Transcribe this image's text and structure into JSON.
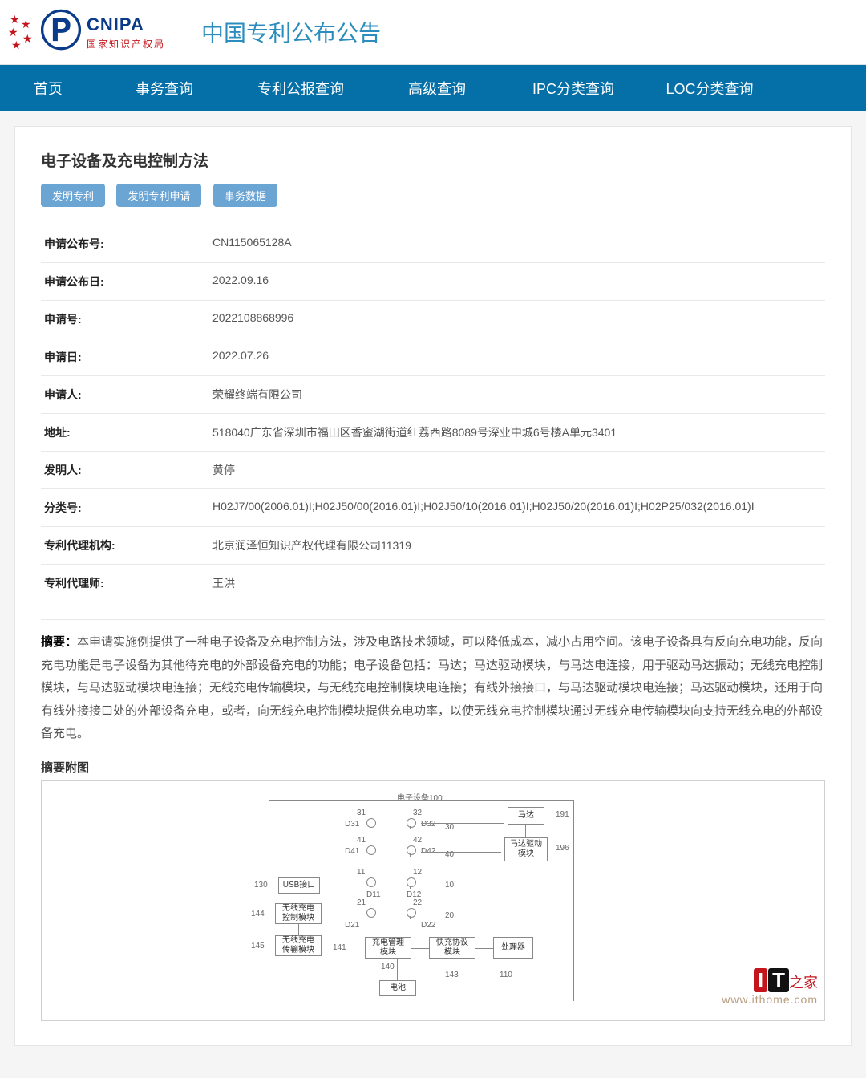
{
  "header": {
    "org_en": "CNIPA",
    "org_cn": "国家知识产权局",
    "site_title": "中国专利公布公告"
  },
  "nav": [
    "首页",
    "事务查询",
    "专利公报查询",
    "高级查询",
    "IPC分类查询",
    "LOC分类查询"
  ],
  "patent": {
    "title": "电子设备及充电控制方法",
    "tags": [
      "发明专利",
      "发明专利申请",
      "事务数据"
    ],
    "fields": [
      {
        "label": "申请公布号:",
        "value": "CN115065128A"
      },
      {
        "label": "申请公布日:",
        "value": "2022.09.16"
      },
      {
        "label": "申请号:",
        "value": "2022108868996"
      },
      {
        "label": "申请日:",
        "value": "2022.07.26"
      },
      {
        "label": "申请人:",
        "value": "荣耀终端有限公司"
      },
      {
        "label": "地址:",
        "value": "518040广东省深圳市福田区香蜜湖街道红荔西路8089号深业中城6号楼A单元3401"
      },
      {
        "label": "发明人:",
        "value": "黄停"
      },
      {
        "label": "分类号:",
        "value": "H02J7/00(2006.01)I;H02J50/00(2016.01)I;H02J50/10(2016.01)I;H02J50/20(2016.01)I;H02P25/032(2016.01)I"
      },
      {
        "label": "专利代理机构:",
        "value": "北京润泽恒知识产权代理有限公司11319"
      },
      {
        "label": "专利代理师:",
        "value": "王洪"
      }
    ],
    "abstract_label": "摘要：",
    "abstract": "本申请实施例提供了一种电子设备及充电控制方法，涉及电路技术领域，可以降低成本，减小占用空间。该电子设备具有反向充电功能，反向充电功能是电子设备为其他待充电的外部设备充电的功能；电子设备包括：马达；马达驱动模块，与马达电连接，用于驱动马达振动；无线充电控制模块，与马达驱动模块电连接；无线充电传输模块，与无线充电控制模块电连接；有线外接接口，与马达驱动模块电连接；马达驱动模块，还用于向有线外接接口处的外部设备充电，或者，向无线充电控制模块提供充电功率，以使无线充电控制模块通过无线充电传输模块向支持无线充电的外部设备充电。",
    "fig_section": "摘要附图"
  },
  "diagram": {
    "title": "电子设备100",
    "blocks": {
      "motor": "马达",
      "motor_drive": "马达驱动模块",
      "usb": "USB接口",
      "wl_ctrl": "无线充电控制模块",
      "wl_tx": "无线充电传输模块",
      "chg_mgmt": "充电管理模块",
      "qc_proto": "快充协议模块",
      "cpu": "处理器",
      "batt": "电池"
    },
    "pins": {
      "d31": "D31",
      "d32": "D32",
      "d41": "D41",
      "d42": "D42",
      "d11": "D11",
      "d12": "D12",
      "d21": "D21",
      "d22": "D22"
    },
    "nums": {
      "n31": "31",
      "n32": "32",
      "n41": "41",
      "n42": "42",
      "n11": "11",
      "n12": "12",
      "n21": "21",
      "n22": "22",
      "n30": "30",
      "n40": "40",
      "n10": "10",
      "n20": "20",
      "n191": "191",
      "n196": "196",
      "n130": "130",
      "n144": "144",
      "n145": "145",
      "n141": "141",
      "n140": "140",
      "n143": "143",
      "n110": "110"
    }
  },
  "watermark": {
    "brand_i": "I",
    "brand_t": "T",
    "brand_zh": "之家",
    "url": "www.ithome.com"
  }
}
